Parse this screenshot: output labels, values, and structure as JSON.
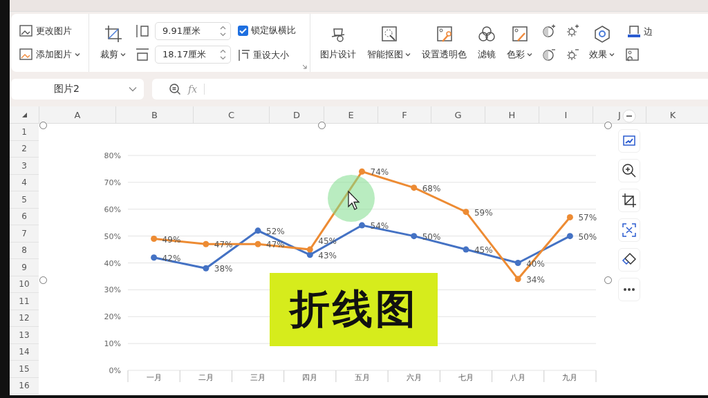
{
  "ribbon": {
    "picture_buttons": [
      {
        "label": "更改图片",
        "dropdown": false
      },
      {
        "label": "添加图片",
        "dropdown": true
      }
    ],
    "crop": {
      "label": "裁剪",
      "dropdown": true
    },
    "height": {
      "value": "9.91厘米"
    },
    "width": {
      "value": "18.17厘米"
    },
    "lock_ratio": {
      "label": "锁定纵横比",
      "checked": true
    },
    "reset_size": {
      "label": "重设大小"
    },
    "tools": [
      {
        "label": "图片设计",
        "dropdown": false
      },
      {
        "label": "智能抠图",
        "dropdown": true
      },
      {
        "label": "设置透明色",
        "dropdown": false
      },
      {
        "label": "滤镜",
        "dropdown": false
      },
      {
        "label": "色彩",
        "dropdown": true
      },
      {
        "label": "效果",
        "dropdown": true
      }
    ],
    "border": {
      "label": "边"
    }
  },
  "name_box": {
    "value": "图片2"
  },
  "formula_bar": {
    "fx": "fx"
  },
  "sheet": {
    "columns": [
      "A",
      "B",
      "C",
      "D",
      "E",
      "F",
      "G",
      "H",
      "I",
      "J",
      "K"
    ],
    "rows": [
      "1",
      "2",
      "3",
      "4",
      "5",
      "6",
      "7",
      "8",
      "9",
      "10",
      "11",
      "12",
      "13",
      "14",
      "15",
      "16"
    ]
  },
  "chart": {
    "caption": "折线图",
    "chart_data": {
      "type": "line",
      "categories": [
        "一月",
        "二月",
        "三月",
        "四月",
        "五月",
        "六月",
        "七月",
        "八月",
        "九月"
      ],
      "series": [
        {
          "color": "#4472c4",
          "marker": "circle",
          "values": [
            42,
            38,
            52,
            43,
            54,
            50,
            45,
            40,
            50
          ],
          "value_labels": [
            "42%",
            "38%",
            "52%",
            "43%",
            "54%",
            "50%",
            "45%",
            "40%",
            "50%"
          ]
        },
        {
          "color": "#ed8b33",
          "marker": "circle",
          "values": [
            49,
            47,
            47,
            45,
            74,
            68,
            59,
            34,
            57
          ],
          "value_labels": [
            "49%",
            "47%",
            "47%",
            "45%",
            "74%",
            "68%",
            "59%",
            "34%",
            "57%"
          ]
        }
      ],
      "ylim": [
        0,
        80
      ],
      "yticks": [
        {
          "value": 0,
          "label": "0%"
        },
        {
          "value": 10,
          "label": "10%"
        },
        {
          "value": 20,
          "label": "20%"
        },
        {
          "value": 30,
          "label": "30%"
        },
        {
          "value": 40,
          "label": "40%"
        },
        {
          "value": 50,
          "label": "50%"
        },
        {
          "value": 60,
          "label": "60%"
        },
        {
          "value": 70,
          "label": "70%"
        },
        {
          "value": 80,
          "label": "80%"
        }
      ],
      "grid": true
    }
  }
}
